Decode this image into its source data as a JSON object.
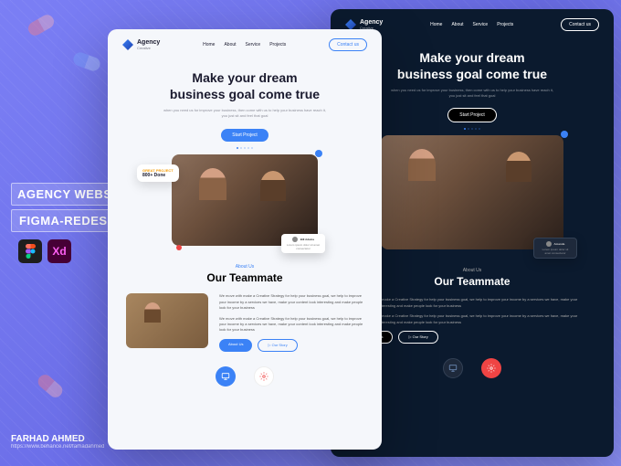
{
  "promo": {
    "line1": "AGENCY WEBSITE",
    "line2": "FIGMA-REDESIGN",
    "tool_figma_label": "F",
    "tool_xd_label": "Xd",
    "author": "FARHAD AHMED",
    "author_sub": "https://www.behance.net/farhadahmed"
  },
  "light": {
    "logo_name": "Agency",
    "logo_sub": "Creative",
    "nav": {
      "home": "Home",
      "about": "About",
      "service": "Service",
      "projects": "Projects"
    },
    "contact_btn": "Contact us",
    "hero_title_1": "Make your dream",
    "hero_title_2": "business goal come true",
    "hero_sub": "when you need us for improve your business, then come with us to help your business have reach it, you just sit and feel that goal",
    "cta": "Start Project",
    "badge_label": "GREAT PROJECT",
    "badge_count": "800+ Done",
    "about_label": "About Us",
    "about_title": "Our Teammate",
    "about_p1": "We move with make a Creative Strategy for help your business goal, we help to improve your income by a services we have, make your content look interesting and make people look for your business",
    "about_p2": "We move with make a Creative Strategy for help your business goal, we help to improve your income by a services we have, make your content look interesting and make people look for your business",
    "btn_about": "About Us",
    "btn_story": "Our Story",
    "testimonial_name": "Bill Adams"
  },
  "dark": {
    "logo_name": "Agency",
    "logo_sub": "Creative",
    "nav": {
      "home": "Home",
      "about": "About",
      "service": "Service",
      "projects": "Projects"
    },
    "contact_btn": "Contact us",
    "hero_title_1": "Make your dream",
    "hero_title_2": "business goal come true",
    "hero_sub": "when you need us for improve your business, then come with us to help your business have reach it, you just sit and feel that goal",
    "cta": "Start Project",
    "about_label": "About Us",
    "about_title": "Our Teammate",
    "about_p1": "We move with make a Creative Strategy for help your business goal, we help to improve your income by a services we have, make your content look interesting and make people look for your business",
    "about_p2": "We move with make a Creative Strategy for help your business goal, we help to improve your income by a services we have, make your content look interesting and make people look for your business",
    "btn_about": "About Us",
    "btn_story": "Our Story",
    "testimonial_name": "Amanda"
  }
}
